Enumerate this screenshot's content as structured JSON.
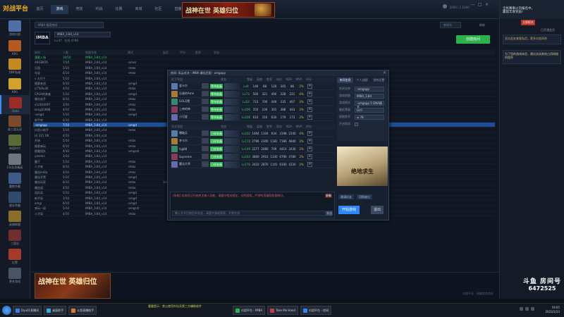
{
  "app": {
    "logo_text": "对战平台",
    "nav": [
      "首页",
      "游戏",
      "竞技",
      "约战",
      "比赛",
      "商城",
      "社区",
      "直播"
    ],
    "active_nav": 1,
    "banner_text": "战神在世 英雄归位",
    "window_controls": [
      "—",
      "□",
      "×"
    ],
    "topright_text": "1000 / 1,1000"
  },
  "sidebar": {
    "items": [
      {
        "label": "游戏对战",
        "color": "#4f6fa8"
      },
      {
        "label": "RPG",
        "color": "#b55a1f"
      },
      {
        "label": "DNF私服",
        "color": "#c28a1f"
      },
      {
        "label": "RPG",
        "color": "#d2a22b"
      },
      {
        "label": "Dota",
        "color": "#9c2c24"
      },
      {
        "label": "真三国无双",
        "color": "#7b4a2a"
      },
      {
        "label": "帝国时代",
        "color": "#5b6b35"
      },
      {
        "label": "CS/反恐精英",
        "color": "#6e7680"
      },
      {
        "label": "魔兽争霸",
        "color": "#3d5b8a"
      },
      {
        "label": "星际争霸",
        "color": "#2f4a6e"
      },
      {
        "label": "英雄联盟",
        "color": "#8a6f2a"
      },
      {
        "label": "三国志",
        "color": "#6e2f2f"
      },
      {
        "label": "红警",
        "color": "#a53a2a"
      },
      {
        "label": "更多游戏",
        "color": "#4a5466"
      }
    ],
    "active_index": 4
  },
  "main": {
    "search_placeholder": "IMBA 搜索房间",
    "search_right": "房间号",
    "search_right2": "刷新",
    "game_logo": "IMBA",
    "game_select": "IMBA_3.84_v14",
    "game_info": "Lv.47 · 在线 4786",
    "create_button": "创建房间",
    "columns": [
      "房间",
      "人数",
      "地图名称",
      "模式",
      "延迟",
      "平均",
      "胜率",
      "状态"
    ],
    "rows": [
      [
        "满载入场",
        "10/10",
        "IMBA_3.84_v14",
        "",
        "",
        "",
        "",
        ""
      ],
      [
        "ARGENTA",
        "7/10",
        "IMBA_3.84_v14",
        "-omsir",
        "",
        "",
        "",
        ""
      ],
      [
        "乐园",
        "5/10",
        "IMBA_3.84_v14",
        "-imba",
        "",
        "",
        "",
        ""
      ],
      [
        "车谈",
        "6/10",
        "IMBA_3.84_v14",
        "-imba",
        "",
        "",
        "",
        ""
      ],
      [
        "v 大开子",
        "5/10",
        "IMBA_3.84_v14",
        "",
        "",
        "",
        "",
        ""
      ],
      [
        "随意来战",
        "6/10",
        "IMBA_3.84_v14",
        "-omgd",
        "",
        "",
        "",
        ""
      ],
      [
        "a7TuRa36",
        "4/10",
        "IMBA_3.84_v14",
        "-imba",
        "",
        "",
        "",
        ""
      ],
      [
        "CPGA的勇者",
        "5/10",
        "IMBA_3.84_v14",
        "-omgd",
        "",
        "",
        "",
        ""
      ],
      [
        "最佳选手",
        "6/10",
        "IMBA_3.84_v14",
        "-imba",
        "",
        "",
        "",
        ""
      ],
      [
        "x12820097",
        "3/10",
        "IMBA_3.84_v14",
        "-imba",
        "",
        "",
        "",
        ""
      ],
      [
        "kong01888",
        "4/10",
        "IMBA_3.84_v14",
        "-imba",
        "",
        "",
        "",
        ""
      ],
      [
        "-omgd",
        "5/10",
        "IMBA_3.84_v14",
        "-omgd",
        "",
        "",
        "",
        ""
      ],
      [
        "新手房",
        "6/10",
        "IMBA_3.84_v14",
        "",
        "",
        "",
        "",
        ""
      ],
      [
        "-omgapp",
        "7/10",
        "IMBA_3.84_v14",
        "-omgd",
        "",
        "",
        "",
        ""
      ],
      [
        "抖音小助手",
        "5/10",
        "IMBA_3.84_v14",
        "-imba",
        "",
        "",
        "",
        ""
      ],
      [
        "LV 321 OK",
        "4/10",
        "IMBA_3.84_v14",
        "",
        "",
        "",
        "",
        ""
      ],
      [
        "开始",
        "5/10",
        "IMBA_3.84_v14",
        "-imba",
        "",
        "",
        "",
        ""
      ],
      [
        "随意来玩",
        "6/10",
        "IMBA_3.84_v14",
        "-imba",
        "",
        "",
        "",
        ""
      ],
      [
        "稳健组队",
        "4/10",
        "IMBA_3.84_v14",
        "-omgsdr",
        "",
        "",
        "",
        ""
      ],
      [
        "yanmin",
        "3/10",
        "IMBA_3.84_v14",
        "",
        "",
        "",
        "",
        ""
      ],
      [
        "圆子",
        "5/10",
        "IMBA_3.84_v14",
        "-imba",
        "",
        "",
        "",
        ""
      ],
      [
        "人才来",
        "6/10",
        "IMBA_3.84_v14",
        "-imba",
        "",
        "",
        "",
        ""
      ],
      [
        "最佳ImBa",
        "4/10",
        "IMBA_3.84_v14",
        "-imba",
        "",
        "",
        "",
        ""
      ],
      [
        "最佳开黑",
        "5/10",
        "IMBA_3.84_v14",
        "-omgd",
        "",
        "",
        "",
        ""
      ],
      [
        "最佳玩家",
        "6/10",
        "IMBA_3.84_v14",
        "-imba",
        "1ms",
        "±30",
        "±12%",
        ""
      ],
      [
        "最佳组",
        "4/10",
        "IMBA_3.84_v14",
        "-imba",
        "",
        "±30",
        "±12%",
        ""
      ],
      [
        "组队局",
        "5/10",
        "IMBA_3.84_v14",
        "-omgd",
        "",
        "",
        "",
        ""
      ],
      [
        "新手局",
        "3/10",
        "IMBA_3.84_v14",
        "-omgd",
        "",
        "",
        "",
        ""
      ],
      [
        "omgr",
        "6/10",
        "IMBA_3.84_v14",
        "-omgd",
        "",
        "",
        "±20%",
        ""
      ],
      [
        "来玩一局",
        "5/10",
        "IMBA_3.84_v14",
        "-omgsdr",
        "",
        "",
        "±11%",
        ""
      ],
      [
        "人才局",
        "4/10",
        "IMBA_3.84_v14",
        "-imba",
        "",
        "",
        "±12%",
        ""
      ]
    ],
    "selected_row": 13
  },
  "dialog": {
    "title": "房间: 风云对决 · IMBA 最佳匹配 · omgapp",
    "close": "×",
    "team_headers": [
      "近卫军团",
      "天灾军团"
    ],
    "stat_headers": [
      "状态",
      "等级",
      "英雄",
      "胜率",
      "场次",
      "KDA",
      "MVP",
      "评分"
    ],
    "team1": [
      {
        "name": "爱卡尔",
        "status": "等待准备",
        "stats": [
          "Lv9",
          "146",
          "68",
          "120",
          "345",
          "86",
          "2%"
        ]
      },
      {
        "name": "乐观的Ame",
        "status": "等待准备",
        "stats": [
          "Lv73",
          "500",
          "321",
          "490",
          "228",
          "221",
          "4%"
        ]
      },
      {
        "name": "GOLD黑",
        "status": "等待准备",
        "stats": [
          "Lv53",
          "723",
          "700",
          "449",
          "235",
          "467",
          "2%"
        ]
      },
      {
        "name": "上帝的神",
        "status": "等待准备",
        "stats": [
          "Lv106",
          "350",
          "100",
          "301",
          "388",
          "443",
          "2%"
        ]
      },
      {
        "name": "小可爱",
        "status": "等待准备",
        "stats": [
          "Lv106",
          "610",
          "316",
          "630",
          "179",
          "173",
          "2%"
        ]
      }
    ],
    "team2": [
      {
        "name": "爆破兵",
        "status": "已经准备",
        "stats": [
          "Lv162",
          "1064",
          "1104",
          "934",
          "3198",
          "2240",
          "4%"
        ]
      },
      {
        "name": "李卡尔",
        "status": "已经准备",
        "stats": [
          "Lv170",
          "2796",
          "2300",
          "1181",
          "7180",
          "4840",
          "2%"
        ]
      },
      {
        "name": "hjg88",
        "status": "已经准备",
        "stats": [
          "Lv149",
          "2277",
          "2080",
          "709",
          "4410",
          "3430",
          "2%"
        ]
      },
      {
        "name": "Supreme",
        "status": "已经准备",
        "stats": [
          "Lv193",
          "3800",
          "2910",
          "1330",
          "6790",
          "4780",
          "2%"
        ]
      },
      {
        "name": "魔法大师",
        "status": "已经准备",
        "stats": [
          "Lv176",
          "3410",
          "2870",
          "1101",
          "6100",
          "4230",
          "2%"
        ]
      }
    ],
    "chat_line": "[系统] 本房间已开启房主踢人功能，请遵守相关规定，文明游戏，严禁利用漏洞恶意刷分。",
    "chat_ctrl": "屏蔽",
    "chat_placeholder": "输入文字后按回车发送，请遵守游戏规则，文明交流",
    "send": "发送",
    "settings_tabs": [
      "房间信息",
      "个人战绩",
      "游戏设置"
    ],
    "settings": [
      {
        "label": "房间名称",
        "value": "-omgapp"
      },
      {
        "label": "游戏地图",
        "value": "IMBA_3.84"
      },
      {
        "label": "游戏模式",
        "value": "-omgapp 5 DNA模式"
      },
      {
        "label": "最低等级",
        "value": "LV.0"
      },
      {
        "label": "限制胜率",
        "value": "≤ 78"
      },
      {
        "label": "开启观战",
        "value": ""
      }
    ],
    "ad_text": "绝地求生",
    "btn_a": "邀请好友",
    "btn_b": "切换座位",
    "start": "开始游戏",
    "quit": "退出"
  },
  "rightcol": {
    "title": "全民赛事火热报名中，赢取丰厚奖励！",
    "tag": "立即报名",
    "status": "已开通会员",
    "msg": "双击此处查看私信，更多对战消息",
    "notice": "为了您的游戏体验，建议关闭其他占用网络的程序",
    "brand": "斗鱼 房间号",
    "room": "6472525"
  },
  "footer": {
    "ad_text": "战神在世 英雄归位",
    "status": "对战平台 · 网络状态良好"
  },
  "taskbar": {
    "tasks": [
      "Dyu01直播间",
      "桌面助手",
      "斗鱼直播助手",
      "对战平台 - IMBA",
      "Take Me Hand",
      "对战平台 - 房间"
    ],
    "ticker": "重要提示：禁止使用外挂及第三方辅助软件",
    "time": "19:05",
    "date": "2023/1/23"
  }
}
